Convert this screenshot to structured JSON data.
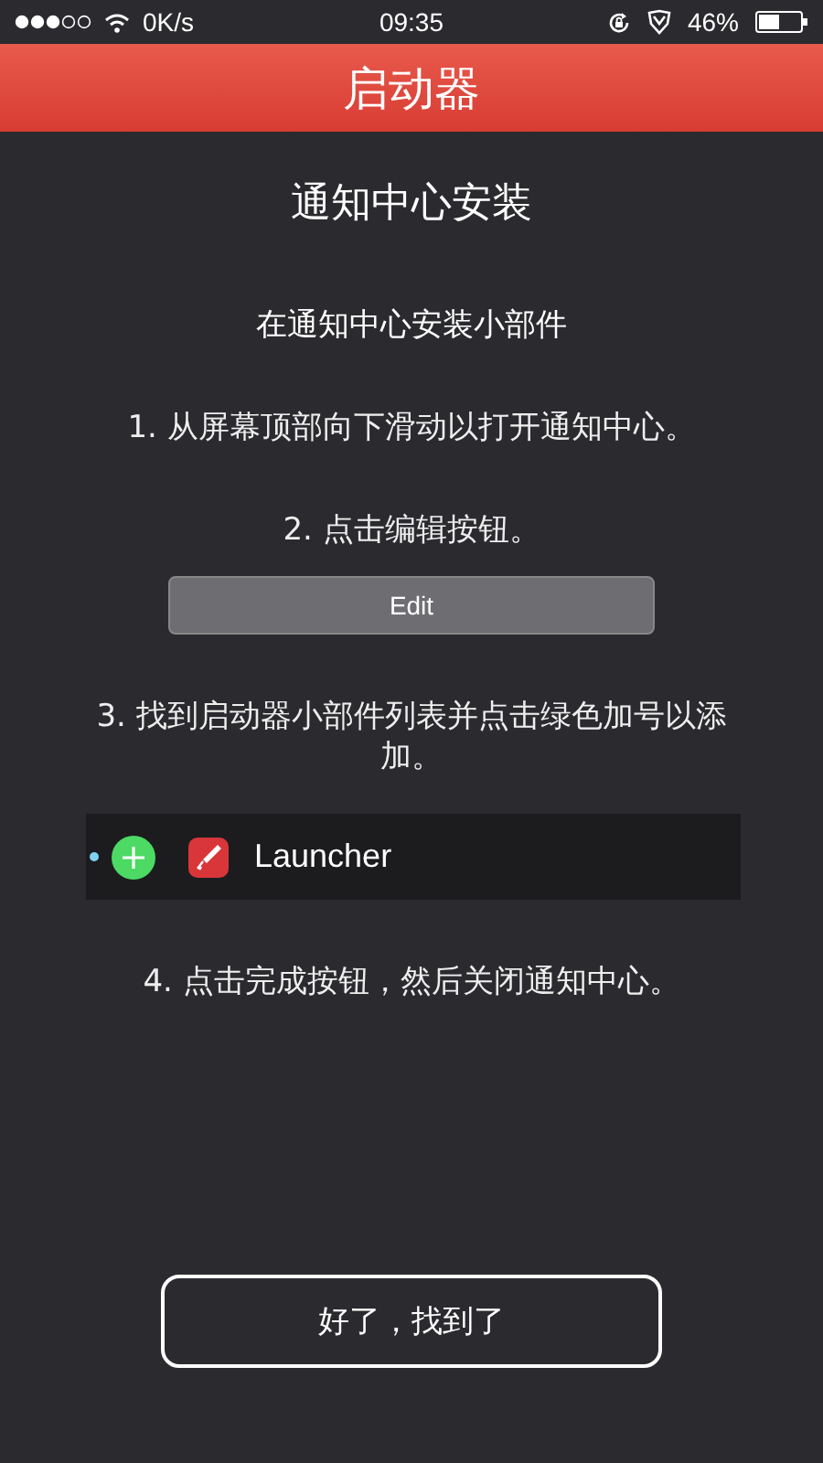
{
  "status_bar": {
    "speed": "0K/s",
    "time": "09:35",
    "battery": "46%"
  },
  "header": {
    "title": "启动器"
  },
  "heading": "通知中心安装",
  "subtitle": "在通知中心安装小部件",
  "steps": [
    {
      "kind": "text",
      "text": "1. 从屏幕顶部向下滑动以打开通知中心。"
    },
    {
      "kind": "text",
      "text": "2. 点击编辑按钮。"
    },
    {
      "kind": "button",
      "text": "Edit"
    },
    {
      "kind": "text",
      "text": "3. 找到启动器小部件列表并点击绿色加号以添加。"
    },
    {
      "kind": "widget",
      "text": "Launcher"
    },
    {
      "kind": "text",
      "text": "4. 点击完成按钮，然后关闭通知中心。"
    }
  ],
  "confirm_button": "好了，找到了"
}
